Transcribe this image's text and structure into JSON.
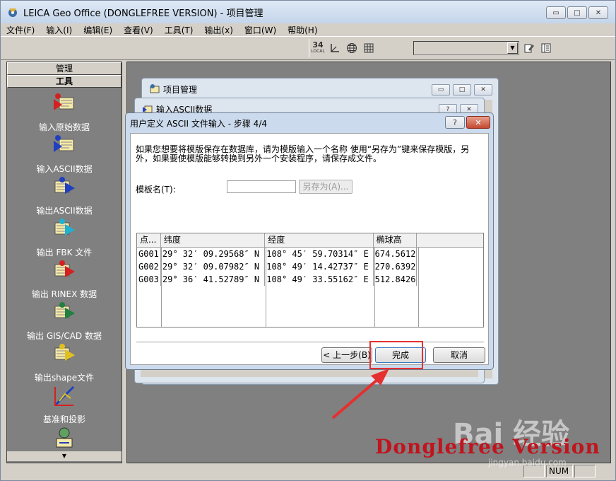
{
  "window": {
    "title": "LEICA Geo Office (DONGLEFREE VERSION) - 项目管理",
    "btn_min": "▭",
    "btn_max": "□",
    "btn_close": "✕"
  },
  "menu": [
    "文件(F)",
    "输入(I)",
    "编辑(E)",
    "查看(V)",
    "工具(T)",
    "输出(x)",
    "窗口(W)",
    "帮助(H)"
  ],
  "toolbar": {
    "btn_34": "34",
    "btn_local": "LOCAL"
  },
  "left_panel": {
    "header_manage": "管理",
    "header_tools": "工具",
    "items": [
      {
        "label": "输入原始数据"
      },
      {
        "label": "输入ASCII数据"
      },
      {
        "label": "输出ASCII数据"
      },
      {
        "label": "输出 FBK 文件"
      },
      {
        "label": "输出 RINEX 数据"
      },
      {
        "label": "输出 GIS/CAD 数据"
      },
      {
        "label": "输出shape文件"
      },
      {
        "label": "基准和投影"
      }
    ],
    "scroll_down": "▼"
  },
  "project_window": {
    "title": "项目管理"
  },
  "ascii_window": {
    "title": "输入ASCII数据",
    "help": "?",
    "close": "✕"
  },
  "dialog": {
    "title": "用户定义 ASCII 文件输入 - 步骤 4/4",
    "help": "?",
    "close": "✕",
    "description": "如果您想要将模版保存在数据库，请为模版输入一个名称 使用“另存为”键来保存模版，另外，如果要使模版能够转换到另外一个安装程序，请保存成文件。",
    "template_label": "模板名(T):",
    "template_value": "",
    "saveas_label": "另存为(A)...",
    "table": {
      "headers": [
        "点...",
        "纬度",
        "经度",
        "椭球高"
      ],
      "rows": [
        [
          "G001",
          "29° 32′ 09.29568″ N",
          "108° 45′ 59.70314″ E",
          "674.5612"
        ],
        [
          "G002",
          "29° 32′ 09.07982″ N",
          "108° 49′ 14.42737″ E",
          "270.6392"
        ],
        [
          "G003",
          "29° 36′ 41.52789″ N",
          "108° 49′ 33.55162″ E",
          "512.8426"
        ]
      ]
    },
    "back_label": "< 上一步(B)",
    "finish_label": "完成",
    "cancel_label": "取消"
  },
  "statusbar": {
    "num": "NUM"
  },
  "overlay": {
    "watermark": "Donglefree Version",
    "baidu": "Bai 经验",
    "baidu_sub": "jingyan.baidu.com"
  },
  "colors": {
    "highlight": "#e53030",
    "watermark": "#c0141e"
  }
}
